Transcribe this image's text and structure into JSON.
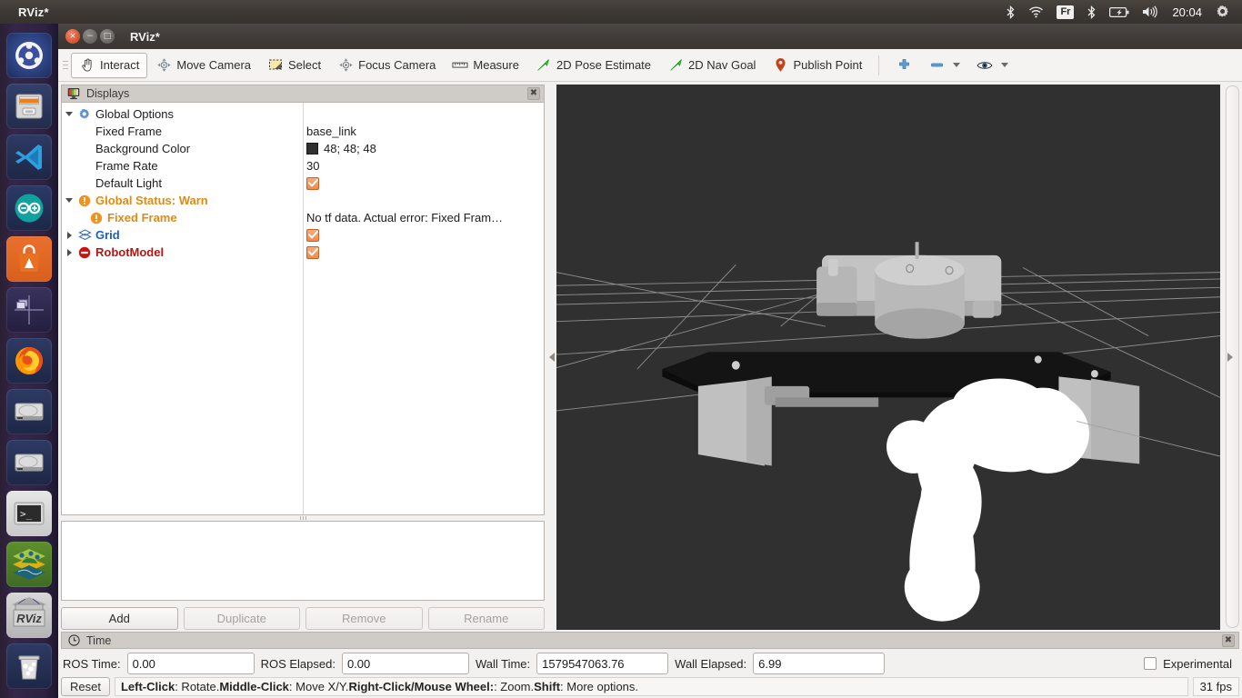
{
  "desktop": {
    "panel_app_title": "RViz*",
    "clock": "20:04",
    "keyboard_layout": "Fr",
    "tray_icons": [
      "bluetooth-icon",
      "wifi-icon",
      "keyboard-layout-indicator",
      "bluetooth-icon",
      "battery-icon",
      "volume-icon",
      "clock",
      "gear-icon"
    ]
  },
  "launcher": {
    "items": [
      {
        "name": "ubuntu-dash",
        "label": "Ubuntu Dash"
      },
      {
        "name": "files",
        "label": "Files"
      },
      {
        "name": "vscode",
        "label": "Visual Studio Code"
      },
      {
        "name": "arduino",
        "label": "Arduino IDE"
      },
      {
        "name": "ubuntu-software",
        "label": "Ubuntu Software"
      },
      {
        "name": "workspace-switcher",
        "label": "Workspace Switcher"
      },
      {
        "name": "firefox",
        "label": "Firefox"
      },
      {
        "name": "disk-1",
        "label": "Disk"
      },
      {
        "name": "disk-2",
        "label": "Disk"
      },
      {
        "name": "terminal",
        "label": "Terminal"
      },
      {
        "name": "gazebo",
        "label": "Gazebo"
      },
      {
        "name": "rviz",
        "label": "RViz"
      },
      {
        "name": "trash",
        "label": "Trash"
      }
    ]
  },
  "window": {
    "title": "RViz*",
    "buttons": {
      "close": "×",
      "minimize": "−",
      "maximize": "□"
    }
  },
  "toolbar": {
    "items": [
      {
        "label": "Interact",
        "icon": "hand-cursor-icon",
        "active": true
      },
      {
        "label": "Move Camera",
        "icon": "move-camera-icon",
        "active": false
      },
      {
        "label": "Select",
        "icon": "select-rectangle-icon",
        "active": false
      },
      {
        "label": "Focus Camera",
        "icon": "focus-camera-icon",
        "active": false
      },
      {
        "label": "Measure",
        "icon": "ruler-icon",
        "active": false
      },
      {
        "label": "2D Pose Estimate",
        "icon": "pose-arrow-icon",
        "active": false
      },
      {
        "label": "2D Nav Goal",
        "icon": "nav-goal-arrow-icon",
        "active": false
      },
      {
        "label": "Publish Point",
        "icon": "map-pin-icon",
        "active": false
      }
    ],
    "extra": [
      {
        "name": "add-tool-button",
        "icon": "plus-icon"
      },
      {
        "name": "remove-tool-button",
        "icon": "minus-icon",
        "caret": true
      },
      {
        "name": "visibility-button",
        "icon": "eye-icon",
        "caret": true
      }
    ]
  },
  "displays_panel": {
    "title": "Displays",
    "title_icon": "monitor-icon",
    "close_icon": "✖",
    "tree": [
      {
        "id": "global-options",
        "label": "Global Options",
        "icon": "gear-icon",
        "expand": "down",
        "indent": 0,
        "style": "normal",
        "value_type": "none"
      },
      {
        "id": "fixed-frame",
        "label": "Fixed Frame",
        "icon": "none",
        "expand": "none",
        "indent": 1,
        "style": "normal",
        "value_type": "text",
        "value": "base_link"
      },
      {
        "id": "background-color",
        "label": "Background Color",
        "icon": "none",
        "expand": "none",
        "indent": 1,
        "style": "normal",
        "value_type": "color",
        "value": "48; 48; 48",
        "color_hex": "#303030"
      },
      {
        "id": "frame-rate",
        "label": "Frame Rate",
        "icon": "none",
        "expand": "none",
        "indent": 1,
        "style": "normal",
        "value_type": "text",
        "value": "30"
      },
      {
        "id": "default-light",
        "label": "Default Light",
        "icon": "none",
        "expand": "none",
        "indent": 1,
        "style": "normal",
        "value_type": "checkbox",
        "checked": true
      },
      {
        "id": "global-status",
        "label": "Global Status: Warn",
        "icon": "warning-icon",
        "expand": "down",
        "indent": 0,
        "style": "warn",
        "value_type": "none"
      },
      {
        "id": "status-fixed-frame",
        "label": "Fixed Frame",
        "icon": "warning-icon",
        "expand": "none",
        "indent": 1,
        "style": "warn",
        "value_type": "text",
        "value": "No tf data.  Actual error: Fixed Fram…"
      },
      {
        "id": "grid",
        "label": "Grid",
        "icon": "grid-icon",
        "expand": "right",
        "indent": 0,
        "style": "grid",
        "value_type": "checkbox",
        "checked": true
      },
      {
        "id": "robotmodel",
        "label": "RobotModel",
        "icon": "error-icon",
        "expand": "right",
        "indent": 0,
        "style": "robot",
        "value_type": "checkbox",
        "checked": true
      }
    ],
    "buttons": [
      {
        "label": "Add",
        "enabled": true
      },
      {
        "label": "Duplicate",
        "enabled": false
      },
      {
        "label": "Remove",
        "enabled": false
      },
      {
        "label": "Rename",
        "enabled": false
      }
    ]
  },
  "viewport": {
    "background_hex": "#303030",
    "grid_color_hex": "#9a9a9a",
    "robot_body_hex": "#b5b5b5",
    "robot_plate_hex": "#1c1c1c",
    "robot_highlight_hex": "#ffffff",
    "collapse_left_icon": "collapse-arrow-left-icon",
    "collapse_right_icon": "collapse-arrow-left-icon"
  },
  "time_panel": {
    "title": "Time",
    "title_icon": "clock-icon",
    "close_icon": "✖",
    "fields": [
      {
        "label": "ROS Time:",
        "value": "0.00",
        "name": "ros-time-field"
      },
      {
        "label": "ROS Elapsed:",
        "value": "0.00",
        "name": "ros-elapsed-field"
      },
      {
        "label": "Wall Time:",
        "value": "1579547063.76",
        "name": "wall-time-field"
      },
      {
        "label": "Wall Elapsed:",
        "value": "6.99",
        "name": "wall-elapsed-field"
      }
    ],
    "experimental_label": "Experimental",
    "experimental_checked": false
  },
  "statusbar": {
    "reset_label": "Reset",
    "hint_parts": [
      {
        "text": "Left-Click",
        "bold": true
      },
      {
        "text": ": Rotate.  ",
        "bold": false
      },
      {
        "text": "Middle-Click",
        "bold": true
      },
      {
        "text": ": Move X/Y.  ",
        "bold": false
      },
      {
        "text": "Right-Click/Mouse Wheel:",
        "bold": true
      },
      {
        "text": ": Zoom.  ",
        "bold": false
      },
      {
        "text": "Shift",
        "bold": true
      },
      {
        "text": ": More options.",
        "bold": false
      }
    ],
    "fps": "31 fps"
  }
}
